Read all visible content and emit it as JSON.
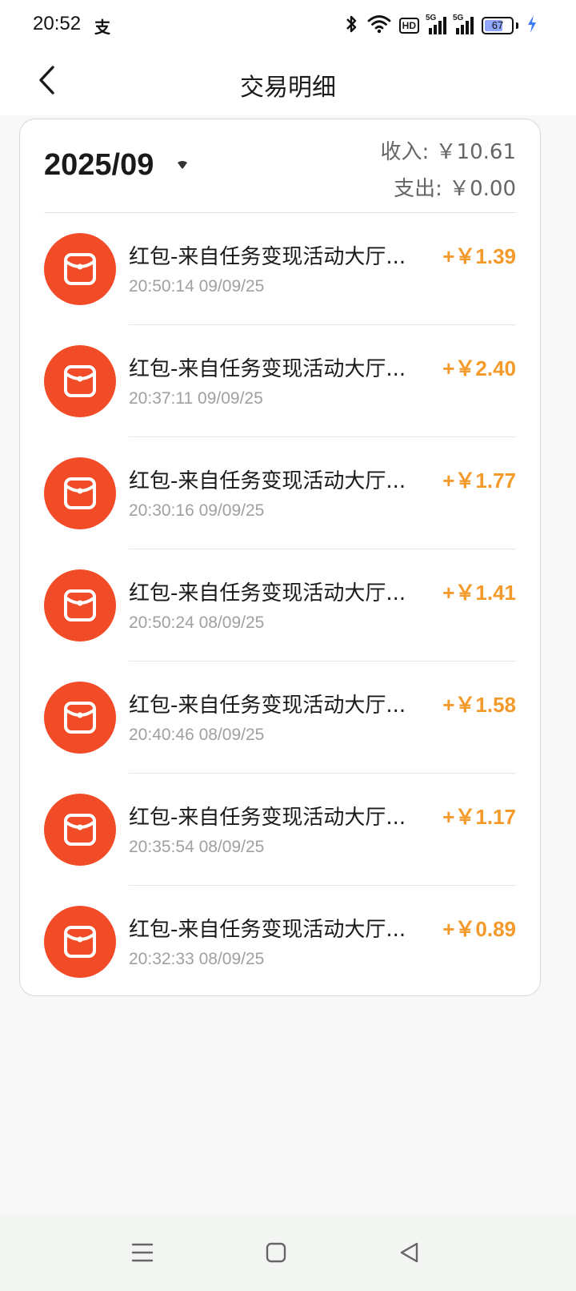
{
  "status_bar": {
    "time": "20:52",
    "notification_glyph": "支",
    "hd_label": "HD",
    "signal_1_label": "5G",
    "signal_2_label": "5G",
    "battery_level": "67",
    "icons": [
      "bluetooth-icon",
      "wifi-icon",
      "hd-voice-icon",
      "signal-5g-icon",
      "signal-5g-icon",
      "battery-icon",
      "charging-icon"
    ]
  },
  "header": {
    "title": "交易明细",
    "back_icon": "chevron-left-icon"
  },
  "summary": {
    "month": "2025/09",
    "income": "收入: ￥10.61",
    "expense": "支出: ￥0.00",
    "dropdown_icon": "caret-down-icon"
  },
  "transactions": [
    {
      "title": "红包-来自任务变现活动大厅...",
      "time": "20:50:14 09/09/25",
      "amount": "+￥1.39"
    },
    {
      "title": "红包-来自任务变现活动大厅...",
      "time": "20:37:11 09/09/25",
      "amount": "+￥2.40"
    },
    {
      "title": "红包-来自任务变现活动大厅...",
      "time": "20:30:16 09/09/25",
      "amount": "+￥1.77"
    },
    {
      "title": "红包-来自任务变现活动大厅...",
      "time": "20:50:24 08/09/25",
      "amount": "+￥1.41"
    },
    {
      "title": "红包-来自任务变现活动大厅...",
      "time": "20:40:46 08/09/25",
      "amount": "+￥1.58"
    },
    {
      "title": "红包-来自任务变现活动大厅...",
      "time": "20:35:54 08/09/25",
      "amount": "+￥1.17"
    },
    {
      "title": "红包-来自任务变现活动大厅...",
      "time": "20:32:33 08/09/25",
      "amount": "+￥0.89"
    }
  ],
  "colors": {
    "accent_red": "#f24b27",
    "amount_orange": "#f39a2a"
  },
  "nav_bar": {
    "icons": [
      "menu-icon",
      "home-square-icon",
      "back-triangle-icon"
    ]
  }
}
